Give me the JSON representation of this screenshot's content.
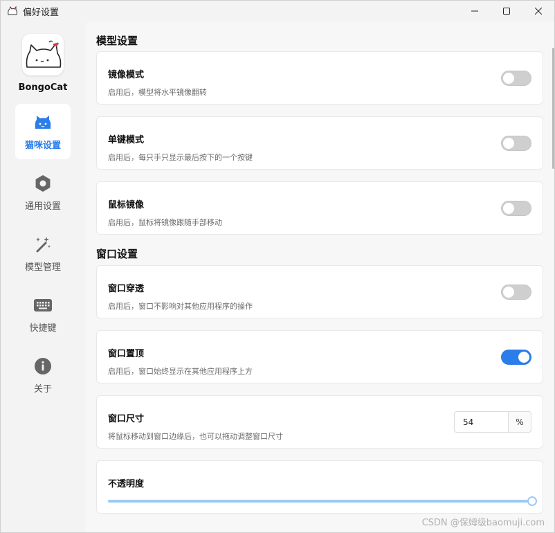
{
  "window": {
    "title": "偏好设置",
    "controls": [
      "minimize-icon",
      "maximize-icon",
      "close-icon"
    ]
  },
  "sidebar": {
    "app_name": "BongoCat",
    "items": [
      {
        "label": "猫咪设置",
        "icon": "cat-icon",
        "active": true
      },
      {
        "label": "通用设置",
        "icon": "hexagon-settings-icon",
        "active": false
      },
      {
        "label": "模型管理",
        "icon": "magic-wand-icon",
        "active": false
      },
      {
        "label": "快捷键",
        "icon": "keyboard-icon",
        "active": false
      },
      {
        "label": "关于",
        "icon": "info-icon",
        "active": false
      }
    ]
  },
  "sections": {
    "model": {
      "title": "模型设置",
      "items": [
        {
          "title": "镜像模式",
          "desc": "启用后，模型将水平镜像翻转",
          "enabled": false
        },
        {
          "title": "单键模式",
          "desc": "启用后，每只手只显示最后按下的一个按键",
          "enabled": false
        },
        {
          "title": "鼠标镜像",
          "desc": "启用后，鼠标将镜像跟随手部移动",
          "enabled": false
        }
      ]
    },
    "window": {
      "title": "窗口设置",
      "items": [
        {
          "title": "窗口穿透",
          "desc": "启用后，窗口不影响对其他应用程序的操作",
          "enabled": false
        },
        {
          "title": "窗口置顶",
          "desc": "启用后，窗口始终显示在其他应用程序上方",
          "enabled": true
        }
      ],
      "size": {
        "title": "窗口尺寸",
        "desc": "将鼠标移动到窗口边缘后，也可以拖动调整窗口尺寸",
        "value": "54",
        "unit": "%"
      },
      "opacity": {
        "title": "不透明度",
        "value_fraction": 1.0
      }
    }
  },
  "colors": {
    "accent": "#2b7de9",
    "slider": "#9ec9f2",
    "toggle_off": "#cfcfcf"
  },
  "watermark": "CSDN @保姆级baomuji.com"
}
